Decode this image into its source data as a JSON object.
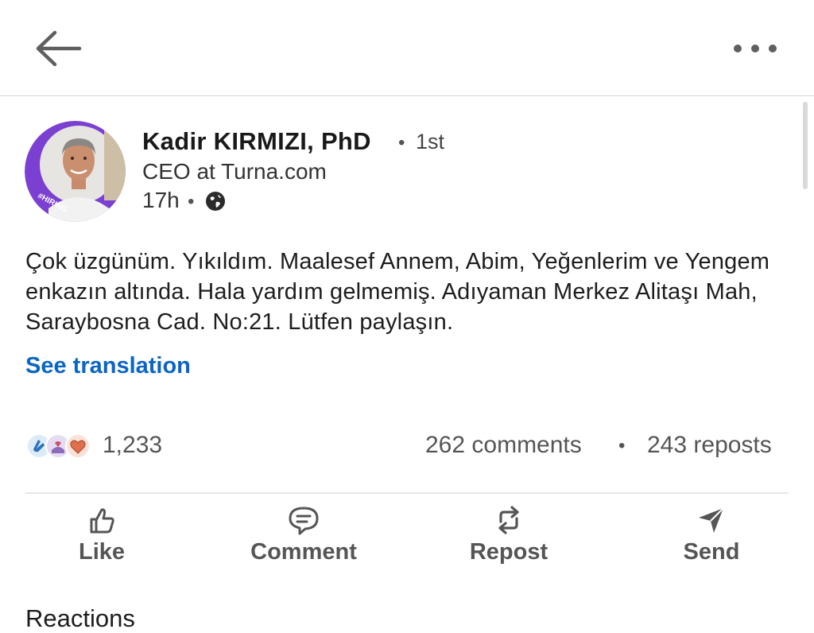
{
  "header": {
    "back_icon": "arrow-left-icon",
    "more_icon": "more-horizontal-icon"
  },
  "post": {
    "author": {
      "name": "Kadir KIRMIZI, PhD",
      "connection_bullet": "•",
      "connection_degree": "1st",
      "headline": "CEO at Turna.com",
      "avatar_badge": "#HIRING"
    },
    "meta": {
      "time": "17h",
      "bullet": "•",
      "visibility_icon": "globe-icon"
    },
    "text": "Çok üzgünüm. Yıkıldım. Maalesef Annem, Abim, Yeğenlerim ve Yengem enkazın altında. Hala yardım gelmemiş. Adıyaman Merkez Alitaşı Mah, Saraybosna Cad. No:21. Lütfen paylaşın.",
    "see_translation": "See translation",
    "social": {
      "reaction_icons": [
        "clap-icon",
        "support-icon",
        "love-icon"
      ],
      "reaction_count": "1,233",
      "comments": "262 comments",
      "separator": "•",
      "reposts": "243 reposts"
    },
    "actions": [
      {
        "label": "Like",
        "icon": "thumbs-up-icon"
      },
      {
        "label": "Comment",
        "icon": "comment-icon"
      },
      {
        "label": "Repost",
        "icon": "repost-icon"
      },
      {
        "label": "Send",
        "icon": "send-icon"
      }
    ]
  },
  "reactions_section": {
    "title": "Reactions"
  },
  "colors": {
    "link_blue": "#0a66c2",
    "hiring_purple": "#7b3fd1",
    "text_gray": "#555555"
  }
}
